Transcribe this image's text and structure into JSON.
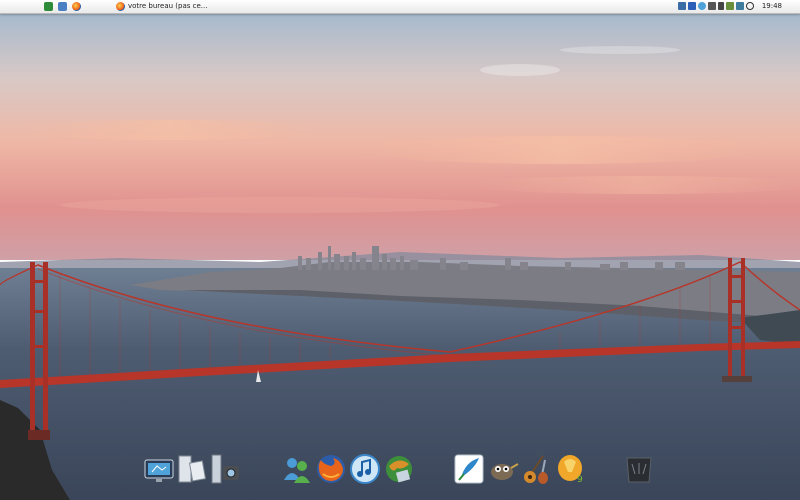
{
  "topbar": {
    "apple_glyph": "",
    "quick_launch": [
      {
        "name": "show-desktop-icon",
        "color": "#2e8b3a"
      },
      {
        "name": "explorer-icon",
        "color": "#4a7fc4"
      },
      {
        "name": "firefox-icon",
        "color": "#e8581a"
      }
    ],
    "task": {
      "title": "votre bureau (pas ce..."
    },
    "tray_icons": [
      {
        "name": "network-icon",
        "color": "#3a6ea5"
      },
      {
        "name": "window-icon",
        "color": "#2b5fb8"
      },
      {
        "name": "globe-icon",
        "color": "#4da3d9"
      },
      {
        "name": "monitor-icon",
        "color": "#555555"
      },
      {
        "name": "eject-icon",
        "color": "#444444"
      },
      {
        "name": "security-icon",
        "color": "#6a8f3c"
      },
      {
        "name": "grid-icon",
        "color": "#3f7b9c"
      },
      {
        "name": "volume-icon",
        "color": "#333333"
      }
    ],
    "clock": "19:48"
  },
  "dock": {
    "apps": [
      {
        "name": "dock-display-settings-icon"
      },
      {
        "name": "dock-documents-icon"
      },
      {
        "name": "dock-camera-tools-icon"
      },
      {
        "name": "dock-messenger-icon"
      },
      {
        "name": "dock-firefox-icon"
      },
      {
        "name": "dock-itunes-icon"
      },
      {
        "name": "dock-gamespy-icon"
      },
      {
        "name": "dock-quill-icon"
      },
      {
        "name": "dock-gimp-icon"
      },
      {
        "name": "dock-guitar-pro-icon"
      },
      {
        "name": "dock-fl-studio-icon"
      },
      {
        "name": "dock-trash-icon"
      }
    ]
  },
  "colors": {
    "sky_top": "#9fb8cf",
    "sky_mid": "#e6c7b8",
    "sky_horizon": "#de8f8f",
    "water": "#4c5a70",
    "bridge_red": "#b8352a"
  }
}
